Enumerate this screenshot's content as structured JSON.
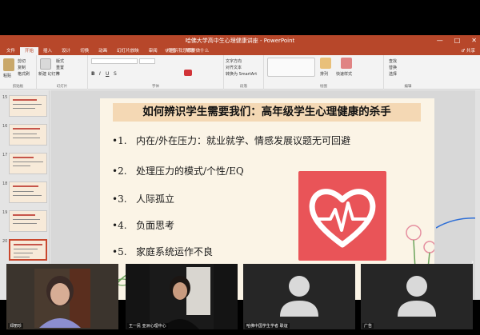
{
  "window": {
    "title": "哈佛大学高中生心理健康讲座 - PowerPoint",
    "minimize_glyph": "—",
    "maximize_glyph": "□",
    "close_glyph": "✕"
  },
  "ribbon": {
    "tabs": [
      "文件",
      "开始",
      "插入",
      "设计",
      "切换",
      "动画",
      "幻灯片放映",
      "审阅",
      "视图",
      "帮助"
    ],
    "active_tab": 1,
    "tell_me": "♀ 告诉我您想要做什么",
    "share": "♂ 共享",
    "groups": {
      "clipboard": "剪贴板",
      "slides": "幻灯片",
      "font": "字体",
      "paragraph": "段落",
      "drawing": "绘图",
      "editing": "编辑"
    },
    "items": {
      "paste": "粘贴",
      "cut": "剪切",
      "copy": "复制",
      "format_painter": "格式刷",
      "new_slide": "新建\n幻灯片",
      "layout": "版式",
      "reset": "重置",
      "section": "节",
      "text_direction": "文字方向",
      "align_text": "对齐文本",
      "smartart": "转换为 SmartArt",
      "arrange": "排列",
      "quick_styles": "快速样式",
      "find": "查找",
      "replace": "替换",
      "select": "选择"
    }
  },
  "slide": {
    "title": "如何辨识学生需要我们：高年级学生心理健康的杀手",
    "bullets": [
      {
        "num": "•1.",
        "text": "内在/外在压力：就业就学、情感发展议题无可回避"
      },
      {
        "num": "•2.",
        "text": "处理压力的模式/个性/EQ"
      },
      {
        "num": "•3.",
        "text": "人际孤立"
      },
      {
        "num": "•4.",
        "text": "负面思考"
      },
      {
        "num": "•5.",
        "text": "家庭系统运作不良"
      }
    ],
    "accent": "#e95458"
  },
  "thumbnails": [
    "15",
    "16",
    "17",
    "18",
    "19",
    "20"
  ],
  "participants": [
    {
      "name": "郑丽珍",
      "video": true
    },
    {
      "name": "王一民 亚洲心理中心",
      "video": true
    },
    {
      "name": "哈佛中国学生学者 联谊",
      "video": false
    },
    {
      "name": "广告",
      "video": false
    }
  ],
  "colors": {
    "ppt_brand": "#b7472a",
    "title_band": "#f4d8b4"
  }
}
